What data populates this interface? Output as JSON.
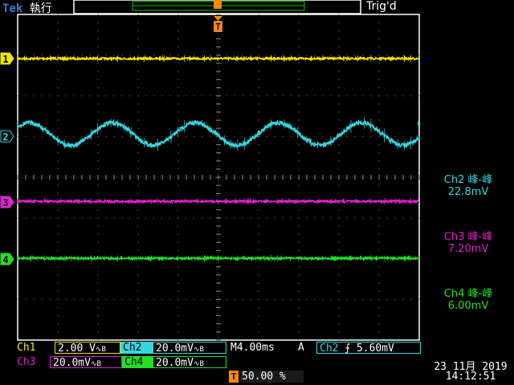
{
  "header": {
    "brand": "Tek",
    "state": "執行",
    "trigger_status": "Trig'd"
  },
  "colors": {
    "ch1": "#f2e600",
    "ch2": "#33d6e0",
    "ch3": "#e020d0",
    "ch4": "#22e022",
    "trigger": "#ff8800",
    "grid": "#8a8a8a",
    "background": "#000000"
  },
  "channel_markers": [
    {
      "id": "ch1",
      "label": "1"
    },
    {
      "id": "ch2",
      "label": "2"
    },
    {
      "id": "ch3",
      "label": "3"
    },
    {
      "id": "ch4",
      "label": "4"
    }
  ],
  "trigger_marker": "T",
  "measurements": [
    {
      "source": "Ch2",
      "type": "峰-峰",
      "value": "22.8mV"
    },
    {
      "source": "Ch3",
      "type": "峰-峰",
      "value": "7.20mV"
    },
    {
      "source": "Ch4",
      "type": "峰-峰",
      "value": "6.00mV"
    }
  ],
  "status": {
    "ch1_label": "Ch1",
    "ch1_scale": "2.00 V",
    "ch2_label": "Ch2",
    "ch2_scale": "20.0mV",
    "ch3_label": "Ch3",
    "ch3_scale": "20.0mV",
    "ch4_label": "Ch4",
    "ch4_scale": "20.0mV",
    "bw_symbol": "∿B",
    "timebase": "M4.00ms",
    "acq_mode": "A",
    "trigger_source": "Ch2",
    "trigger_slope": "⨍",
    "trigger_level": "5.60mV",
    "trigger_position": "50.00 %",
    "date": "23 11月 2019",
    "time": "14:12:51"
  }
}
